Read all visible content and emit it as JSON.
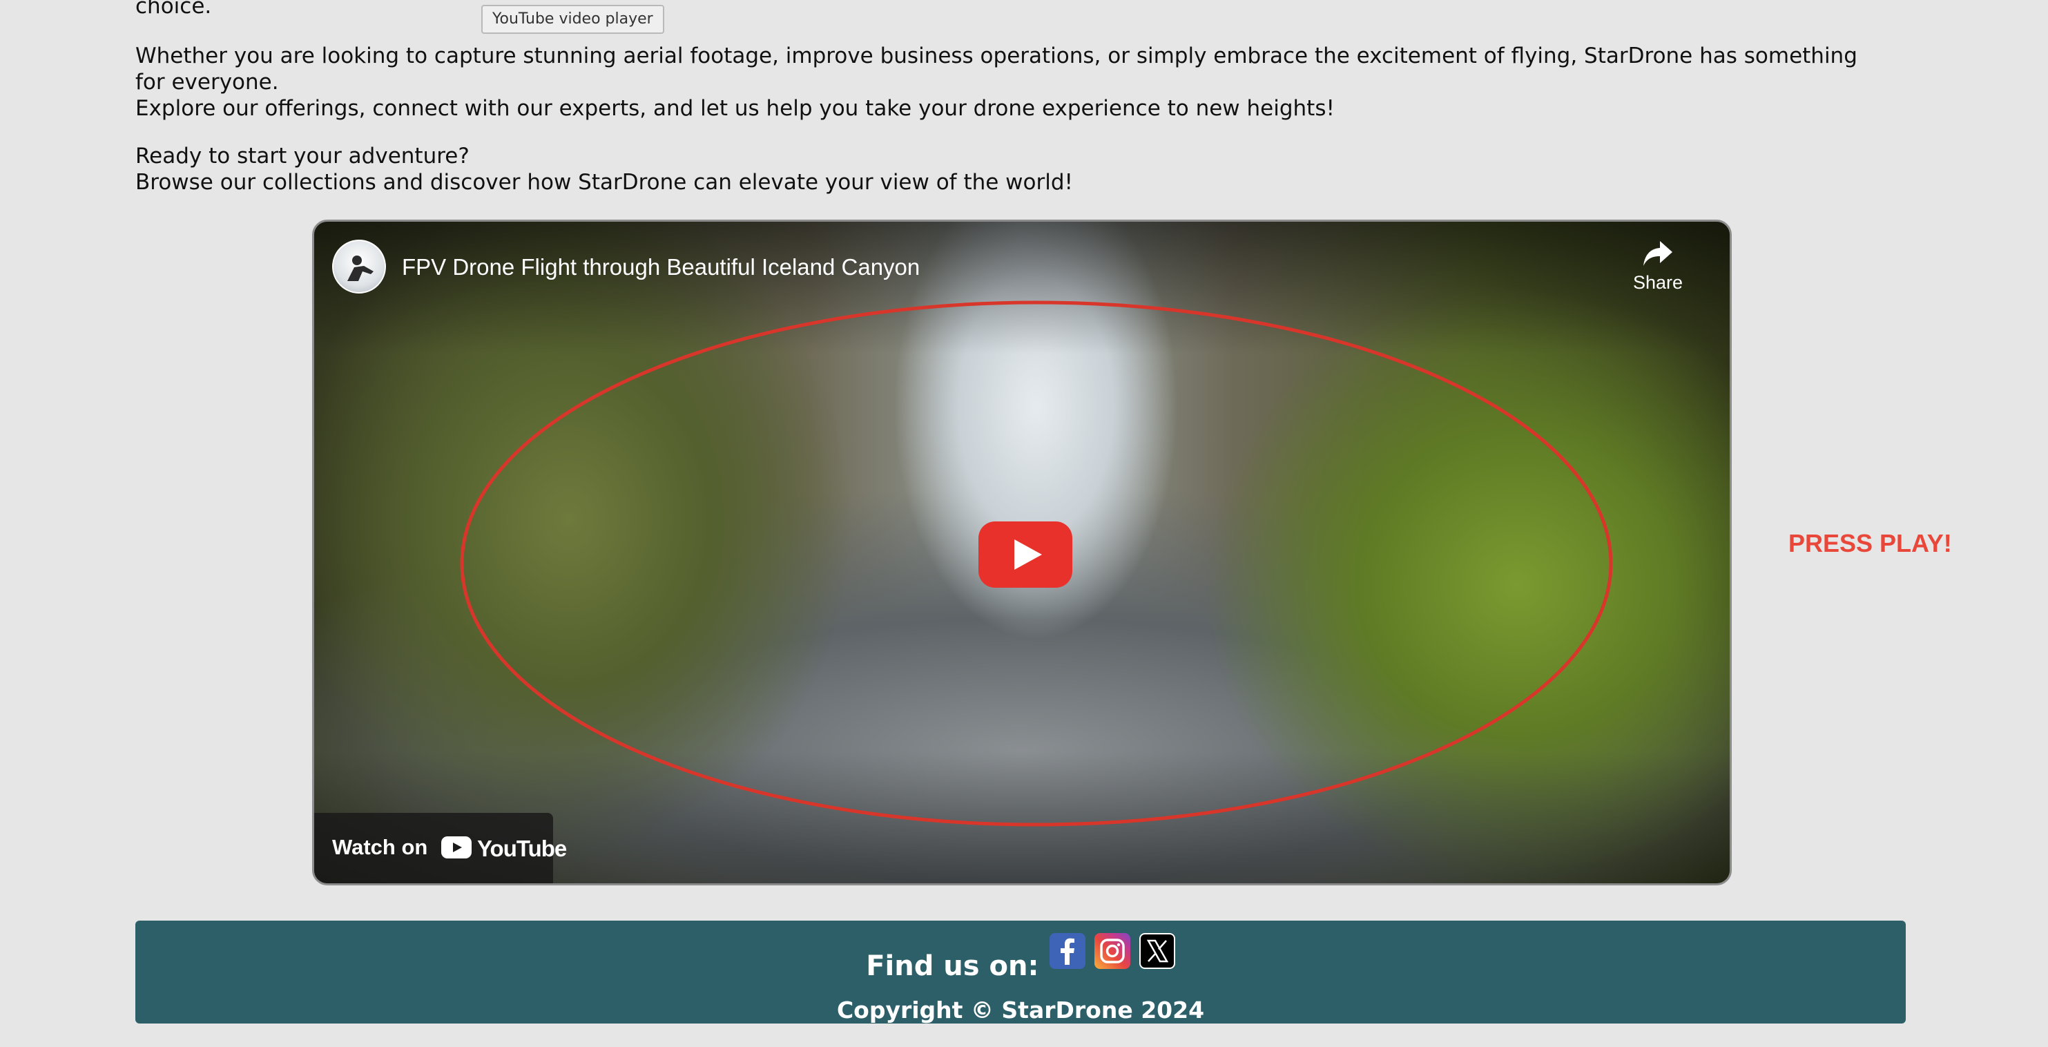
{
  "intro": {
    "top_line": "choice.",
    "paragraph_1": [
      "Whether you are looking to capture stunning aerial footage, improve business operations, or simply embrace the excitement of flying, StarDrone has something",
      "for everyone.",
      "Explore our offerings, connect with our experts, and let us help you take your drone experience to new heights!"
    ],
    "paragraph_2": [
      "Ready to start your adventure?",
      "Browse our collections and discover how StarDrone can elevate your view of the world!"
    ]
  },
  "tooltip": "YouTube video player",
  "video": {
    "title": "FPV Drone Flight through Beautiful Iceland Canyon",
    "share_label": "Share",
    "watch_on_label": "Watch on",
    "youtube_logo_text": "YouTube",
    "play_button_color": "#e8312a",
    "highlight_color": "#d9362b"
  },
  "annotation": {
    "press_play": "PRESS PLAY!"
  },
  "footer": {
    "find_us_label": "Find us on:",
    "social": [
      {
        "name": "facebook",
        "icon": "facebook-icon"
      },
      {
        "name": "instagram",
        "icon": "instagram-icon"
      },
      {
        "name": "x",
        "icon": "x-icon"
      }
    ],
    "copyright": "Copyright © StarDrone 2024",
    "background_color": "#2c5f68"
  }
}
